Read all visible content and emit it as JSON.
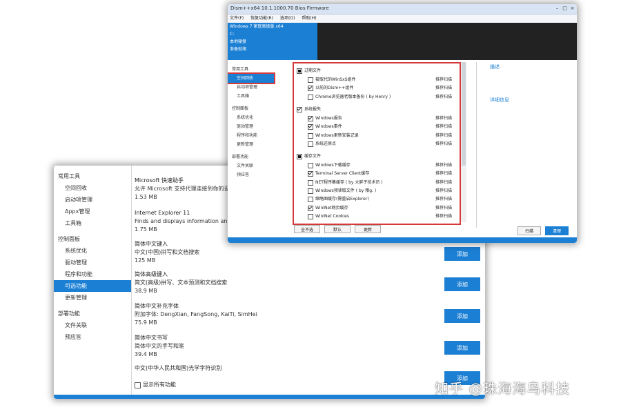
{
  "back_window": {
    "sidebar": [
      {
        "label": "常用工具",
        "type": "group"
      },
      {
        "label": "空间回收",
        "type": "sub"
      },
      {
        "label": "启动项管理",
        "type": "sub"
      },
      {
        "label": "Appx管理",
        "type": "sub"
      },
      {
        "label": "工具箱",
        "type": "sub"
      },
      {
        "label": "控制面板",
        "type": "group"
      },
      {
        "label": "系统优化",
        "type": "sub"
      },
      {
        "label": "驱动管理",
        "type": "sub"
      },
      {
        "label": "程序和功能",
        "type": "sub"
      },
      {
        "label": "可选功能",
        "type": "sub",
        "active": true
      },
      {
        "label": "更新管理",
        "type": "sub"
      },
      {
        "label": "部署功能",
        "type": "group"
      },
      {
        "label": "文件关联",
        "type": "sub"
      },
      {
        "label": "预应答",
        "type": "sub"
      }
    ],
    "features": [
      {
        "title": "Microsoft 快速助手",
        "desc": "允许 Microsoft 支持代理连接到你的设",
        "size": "1.53 MB"
      },
      {
        "title": "Internet Explorer 11",
        "desc": "Finds and displays information and",
        "size": "1.75 MB"
      },
      {
        "title": "简体中文键入",
        "desc": "中文(中国)拼写和文档搜索",
        "size": "125 MB",
        "button": "添加"
      },
      {
        "title": "简体高级键入",
        "desc": "简文(高级)拼写、文本预测和文档搜索",
        "size": "38.9 MB",
        "button": "添加"
      },
      {
        "title": "简体中文补充字体",
        "desc": "附加字体: DengXian, FangSong, KaiTi, SimHei",
        "size": "75.9 MB",
        "button": "添加"
      },
      {
        "title": "简体中文书写",
        "desc": "简体中文的手写和笔",
        "size": "39.4 MB",
        "button": "添加"
      },
      {
        "title": "中文(中华人民共和国)光学字符识别",
        "desc": "",
        "size": "",
        "button": "添加"
      }
    ],
    "show_installed_label": "显示所有功能"
  },
  "front_window": {
    "title": "Dism++x64 10.1.1000.70 Bios Firmware",
    "menu": [
      "文件(F)",
      "恢复功能(R)",
      "选项(O)",
      "帮助(H)"
    ],
    "header_lines": [
      "Windows 7 家庭高级版 x64",
      "C:",
      "本地硬盘",
      "准备就绪"
    ],
    "sidebar": [
      {
        "label": "常用工具",
        "type": "group"
      },
      {
        "label": "空间回收",
        "type": "sub",
        "active": true
      },
      {
        "label": "启动项管理",
        "type": "sub"
      },
      {
        "label": "工具箱",
        "type": "sub"
      },
      {
        "label": "控制面板",
        "type": "group"
      },
      {
        "label": "系统优化",
        "type": "sub"
      },
      {
        "label": "驱动管理",
        "type": "sub"
      },
      {
        "label": "程序和功能",
        "type": "sub"
      },
      {
        "label": "更新管理",
        "type": "sub"
      },
      {
        "label": "部署功能",
        "type": "group"
      },
      {
        "label": "文件关联",
        "type": "sub"
      },
      {
        "label": "预应答",
        "type": "sub"
      }
    ],
    "categories": [
      {
        "label": "过期文件",
        "state": "partial",
        "items": [
          {
            "label": "被取代的WinSxS组件",
            "type": "推荐扫描",
            "checked": false
          },
          {
            "label": "以前的Dism++组件",
            "type": "推荐扫描",
            "checked": true
          },
          {
            "label": "Chrome浏览器老版本备份 ( by Henry )",
            "type": "推荐扫描",
            "checked": false
          }
        ]
      },
      {
        "label": "系统报失",
        "state": "checked",
        "items": [
          {
            "label": "Windows报告",
            "type": "推荐扫描",
            "checked": true
          },
          {
            "label": "Windows事件",
            "type": "推荐扫描",
            "checked": true
          },
          {
            "label": "Windows更新安装记录",
            "type": "推荐扫描",
            "checked": false
          },
          {
            "label": "系统还原点",
            "type": "推荐扫描",
            "checked": false
          }
        ]
      },
      {
        "label": "缓存文件",
        "state": "partial",
        "items": [
          {
            "label": "Windows下载缓存",
            "type": "推荐扫描",
            "checked": false
          },
          {
            "label": "Terminal Server Client缓存",
            "type": "推荐扫描",
            "checked": true
          },
          {
            "label": "NET程序集缓存 ( by 大胖子技术员 )",
            "type": "推荐扫描",
            "checked": false
          },
          {
            "label": "Windows预读取文件 ( by 粮g. )",
            "type": "推荐扫描",
            "checked": false
          },
          {
            "label": "缩略图缓存(需重启Explorer)",
            "type": "推荐扫描",
            "checked": false
          },
          {
            "label": "WinINet网页缓存",
            "type": "推荐扫描",
            "checked": true
          },
          {
            "label": "WinINet Cookies",
            "type": "推荐扫描",
            "checked": false
          }
        ]
      }
    ],
    "panel_buttons": [
      "全不选",
      "默认",
      "更新"
    ],
    "right_links": [
      "描述",
      "详细信息"
    ],
    "scan_label": "扫描",
    "clean_label": "清理"
  },
  "watermark": "知乎 @珠海海鸟科技",
  "colors": {
    "accent": "#1b7fd4",
    "highlight": "#d53a3a",
    "header_dark": "#222222"
  }
}
